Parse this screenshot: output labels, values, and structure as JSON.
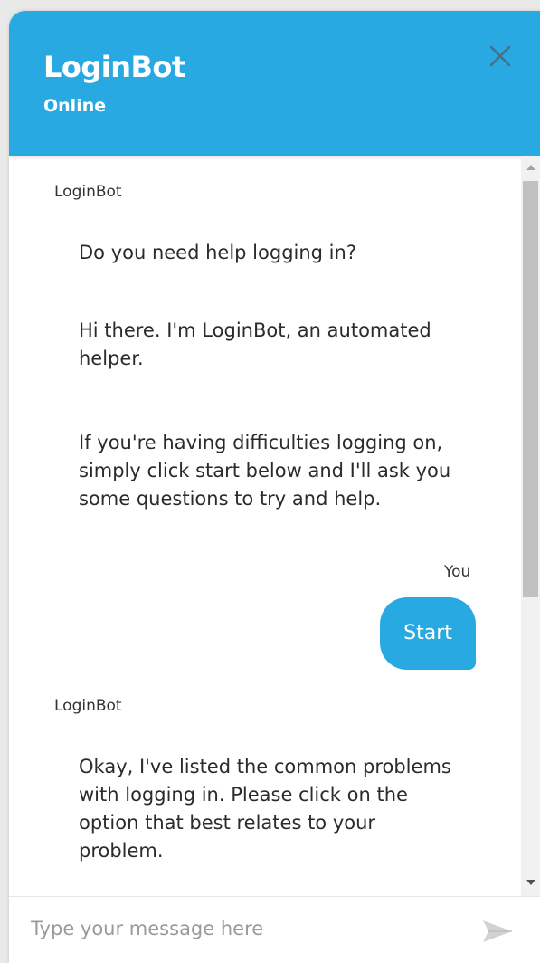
{
  "header": {
    "title": "LoginBot",
    "status": "Online",
    "close_icon": "close-icon",
    "background_color": "#29a9e1"
  },
  "messages": [
    {
      "sender": "LoginBot",
      "lines": [
        "Do you need help logging in?",
        "Hi there. I'm LoginBot, an automated helper.",
        "If you're having difficulties logging on, simply click start below and I'll ask you some questions to try and help."
      ]
    },
    {
      "sender": "You",
      "text": "Start"
    },
    {
      "sender": "LoginBot",
      "lines": [
        "Okay, I've listed the common problems with logging in. Please click on the option that best relates to your problem."
      ]
    }
  ],
  "composer": {
    "placeholder": "Type your message here",
    "value": "",
    "send_icon": "send-icon"
  }
}
